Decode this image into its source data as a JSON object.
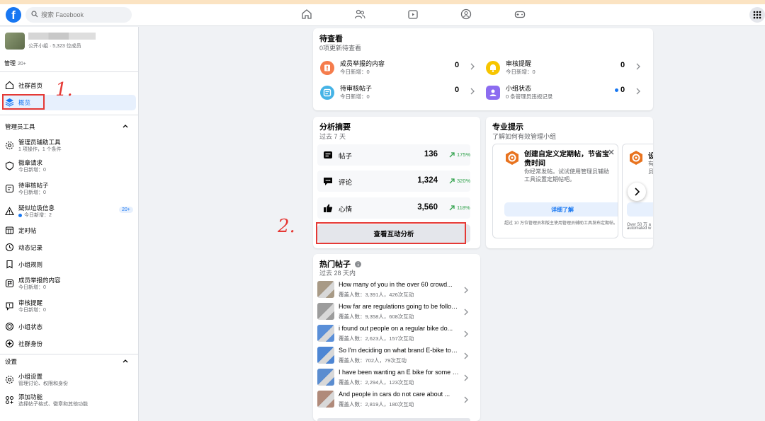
{
  "topbar": {
    "search_placeholder": "搜索 Facebook",
    "logo": "f",
    "nav_icons": [
      "home-icon",
      "friends-icon",
      "watch-icon",
      "groups-icon",
      "gaming-icon"
    ]
  },
  "sidebar": {
    "group_meta": "公开小组 · 5,323 位成员",
    "manage_label": "管理",
    "manage_count": "20+",
    "top_items": [
      {
        "label": "社群首页",
        "icon": "home-icon"
      },
      {
        "label": "概览",
        "icon": "layers-icon"
      }
    ],
    "admin_tools_title": "管理员工具",
    "admin_items": [
      {
        "label": "管理员辅助工具",
        "sub": "1 项操作，1 个条件"
      },
      {
        "label": "徽章请求",
        "sub": "今日新增：0"
      },
      {
        "label": "待审核帖子",
        "sub": "今日新增：0"
      },
      {
        "label": "疑似垃圾信息",
        "sub": "今日新增：2",
        "badge": "20+"
      },
      {
        "label": "定时帖",
        "sub": ""
      },
      {
        "label": "动态记录",
        "sub": ""
      },
      {
        "label": "小组规则",
        "sub": ""
      },
      {
        "label": "成员举报的内容",
        "sub": "今日新增：0"
      },
      {
        "label": "审核提醒",
        "sub": "今日新增：0"
      },
      {
        "label": "小组状态",
        "sub": ""
      },
      {
        "label": "社群身份",
        "sub": ""
      }
    ],
    "settings_title": "设置",
    "settings_items": [
      {
        "label": "小组设置",
        "sub": "管理讨论、权限和身份"
      },
      {
        "label": "添加功能",
        "sub": "选择帖子格式、徽章和其他功能"
      }
    ]
  },
  "pending": {
    "title": "待查看",
    "subtitle": "0项更新待查看",
    "items": [
      {
        "label": "成员举报的内容",
        "sub": "今日新增：0",
        "value": "0",
        "color": "#f57c4c"
      },
      {
        "label": "审核提醒",
        "sub": "今日新增：0",
        "value": "0",
        "color": "#f7c500"
      },
      {
        "label": "待审核帖子",
        "sub": "今日新增：0",
        "value": "0",
        "color": "#45b3e6"
      },
      {
        "label": "小组状态",
        "sub": "0 条管理员违规记录",
        "value": "0",
        "color": "#8c6cf0"
      }
    ]
  },
  "analytics": {
    "title": "分析摘要",
    "subtitle": "过去 7 天",
    "rows": [
      {
        "label": "帖子",
        "value": "136",
        "pct": "175%"
      },
      {
        "label": "评论",
        "value": "1,324",
        "pct": "320%"
      },
      {
        "label": "心情",
        "value": "3,560",
        "pct": "118%"
      }
    ],
    "button": "查看互动分析"
  },
  "tips": {
    "title": "专业提示",
    "subtitle": "了解如何有效管理小组",
    "card1": {
      "title": "创建自定义定期帖，节省宝贵时间",
      "desc": "你经常发帖。试试使用管理员辅助工具设置定期帖吧。",
      "button": "详细了解",
      "foot": "超过 10 万位管理员和版主使用管理员辅助工具发布定期帖。"
    },
    "card2": {
      "title": "设",
      "desc_lines": [
        "有",
        "员"
      ],
      "foot_lines": [
        "Over 50 万 a",
        "automated w"
      ]
    }
  },
  "hot": {
    "title": "热门帖子",
    "subtitle": "过去 28 天内",
    "posts": [
      {
        "title": "How many of you in the over 60 crowd...",
        "meta": "覆盖人数：3,391人，426次互动",
        "color": "#a89a86"
      },
      {
        "title": "How far are regulations going to be followed...",
        "meta": "覆盖人数：9,358人，608次互动",
        "color": "#9c9c9c"
      },
      {
        "title": "i found out people on a regular bike do...",
        "meta": "覆盖人数：2,623人，157次互动",
        "color": "#5a8fd8"
      },
      {
        "title": "So I'm deciding on what brand E-bike to get...",
        "meta": "覆盖人数：702人，79次互动",
        "color": "#4d86d4"
      },
      {
        "title": "I have been wanting an E bike for some time...",
        "meta": "覆盖人数：2,294人，123次互动",
        "color": "#5b8dd0"
      },
      {
        "title": "And people in cars do not care about ...",
        "meta": "覆盖人数：2,819人，180次互动",
        "color": "#b08a7a"
      }
    ]
  },
  "annotations": {
    "one": "1.",
    "two": "2."
  }
}
